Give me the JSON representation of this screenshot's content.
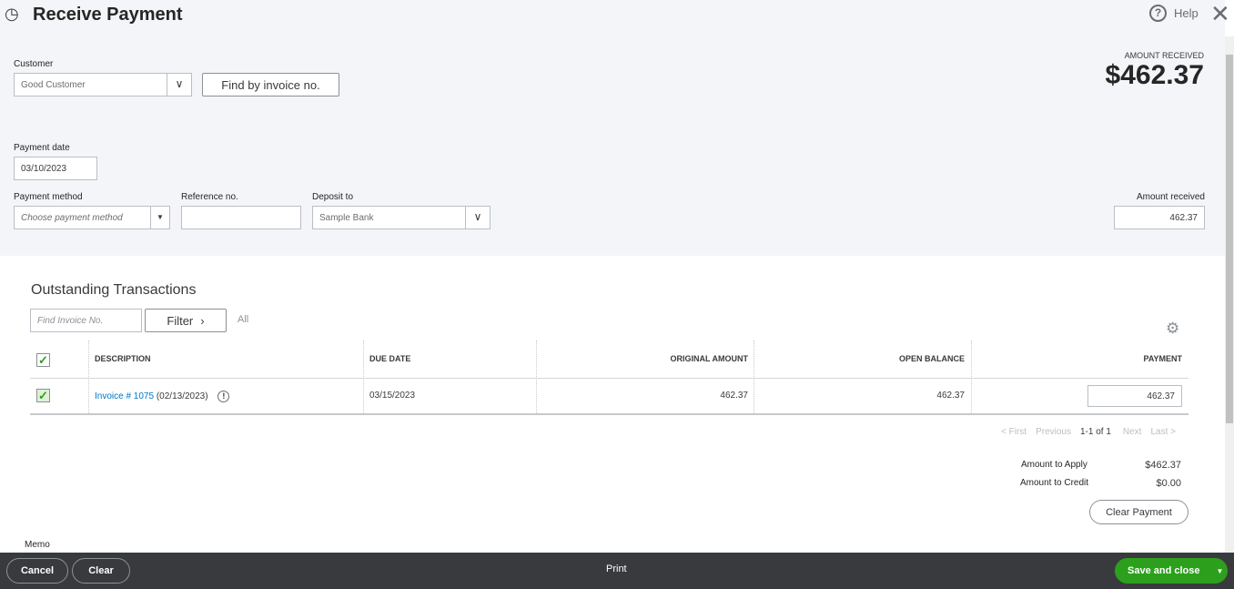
{
  "header": {
    "title": "Receive Payment",
    "help": "Help"
  },
  "customer": {
    "label": "Customer",
    "value": "Good Customer",
    "find_button": "Find by invoice no."
  },
  "amount_received_header": {
    "label": "AMOUNT RECEIVED",
    "value": "$462.37"
  },
  "payment_date": {
    "label": "Payment date",
    "value": "03/10/2023"
  },
  "payment_method": {
    "label": "Payment method",
    "placeholder": "Choose payment method"
  },
  "reference": {
    "label": "Reference no.",
    "value": ""
  },
  "deposit_to": {
    "label": "Deposit to",
    "value": "Sample Bank"
  },
  "amount_received": {
    "label": "Amount received",
    "value": "462.37"
  },
  "outstanding": {
    "title": "Outstanding Transactions",
    "find_placeholder": "Find Invoice No.",
    "filter": "Filter",
    "all": "All",
    "columns": [
      "DESCRIPTION",
      "DUE DATE",
      "ORIGINAL AMOUNT",
      "OPEN BALANCE",
      "PAYMENT"
    ],
    "rows": [
      {
        "link": "Invoice # 1075",
        "date": "(02/13/2023)",
        "due": "03/15/2023",
        "original": "462.37",
        "open": "462.37",
        "payment": "462.37"
      }
    ]
  },
  "pagination": {
    "first": "< First",
    "previous": "Previous",
    "range": "1-1 of 1",
    "next": "Next",
    "last": "Last >"
  },
  "totals": {
    "apply_label": "Amount to Apply",
    "apply_value": "$462.37",
    "credit_label": "Amount to Credit",
    "credit_value": "$0.00",
    "clear_payment": "Clear Payment"
  },
  "memo": {
    "label": "Memo"
  },
  "footer": {
    "cancel": "Cancel",
    "clear": "Clear",
    "print": "Print",
    "save": "Save and close"
  }
}
